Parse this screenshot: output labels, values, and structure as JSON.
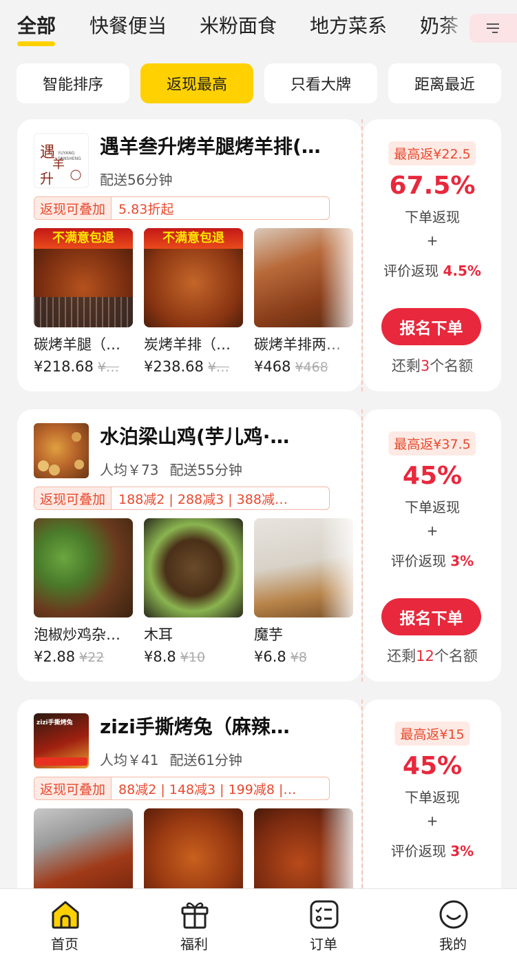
{
  "category_tabs": [
    {
      "label": "全部",
      "active": true
    },
    {
      "label": "快餐便当",
      "active": false
    },
    {
      "label": "米粉面食",
      "active": false
    },
    {
      "label": "地方菜系",
      "active": false
    },
    {
      "label": "奶茶",
      "active": false
    }
  ],
  "sort_chips": [
    {
      "label": "智能排序",
      "active": false
    },
    {
      "label": "返现最高",
      "active": true
    },
    {
      "label": "只看大牌",
      "active": false
    },
    {
      "label": "距离最近",
      "active": false
    }
  ],
  "cards": [
    {
      "name": "遇羊叁升烤羊腿烤羊排(…",
      "logo_text": "遇羊叁升",
      "avg_price": "",
      "delivery": "配送56分钟",
      "promo_tag": "返现可叠加",
      "promo_text": "5.83折起",
      "dishes": [
        {
          "name": "碳烤羊腿（…",
          "price": "¥218.68",
          "old_price": "¥…",
          "banner": "不满意包退"
        },
        {
          "name": "炭烤羊排（…",
          "price": "¥238.68",
          "old_price": "¥…",
          "banner": "不满意包退"
        },
        {
          "name": "碳烤羊排两…",
          "price": "¥468",
          "old_price": "¥468",
          "banner": ""
        }
      ],
      "max_cashback": "最高返¥22.5",
      "percent": "67.5%",
      "order_label": "下单返现",
      "plus": "+",
      "review_label": "评价返现",
      "review_pct": "4.5%",
      "button": "报名下单",
      "remain_prefix": "还剩",
      "remain_count": "3",
      "remain_suffix": "个名额"
    },
    {
      "name": "水泊梁山鸡(芋儿鸡·…",
      "logo_text": "",
      "avg_price": "人均￥73",
      "delivery": "配送55分钟",
      "promo_tag": "返现可叠加",
      "promo_text": "188减2 | 288减3 | 388减…",
      "dishes": [
        {
          "name": "泡椒炒鸡杂…",
          "price": "¥2.88",
          "old_price": "¥22",
          "banner": ""
        },
        {
          "name": "木耳",
          "price": "¥8.8",
          "old_price": "¥10",
          "banner": ""
        },
        {
          "name": "魔芋",
          "price": "¥6.8",
          "old_price": "¥8",
          "banner": ""
        }
      ],
      "max_cashback": "最高返¥37.5",
      "percent": "45%",
      "order_label": "下单返现",
      "plus": "+",
      "review_label": "评价返现",
      "review_pct": "3%",
      "button": "报名下单",
      "remain_prefix": "还剩",
      "remain_count": "12",
      "remain_suffix": "个名额"
    },
    {
      "name": "zizi手撕烤兔（麻辣…",
      "logo_text": "zizi手撕烤兔",
      "avg_price": "人均￥41",
      "delivery": "配送61分钟",
      "promo_tag": "返现可叠加",
      "promo_text": "88减2 | 148减3 | 199减8 |…",
      "dishes": [
        {
          "name": "",
          "price": "",
          "old_price": "",
          "banner": ""
        },
        {
          "name": "",
          "price": "",
          "old_price": "",
          "banner": ""
        },
        {
          "name": "",
          "price": "",
          "old_price": "",
          "banner": ""
        }
      ],
      "max_cashback": "最高返¥15",
      "percent": "45%",
      "order_label": "下单返现",
      "plus": "+",
      "review_label": "评价返现",
      "review_pct": "3%",
      "button": "",
      "remain_prefix": "",
      "remain_count": "",
      "remain_suffix": ""
    }
  ],
  "bottom_nav": [
    {
      "label": "首页",
      "icon": "home-icon",
      "active": true
    },
    {
      "label": "福利",
      "icon": "gift-icon",
      "active": false
    },
    {
      "label": "订单",
      "icon": "order-icon",
      "active": false
    },
    {
      "label": "我的",
      "icon": "profile-icon",
      "active": false
    }
  ],
  "colors": {
    "accent_yellow": "#ffd100",
    "cashback_red": "#e8283c",
    "promo_orange": "#e8492f"
  }
}
